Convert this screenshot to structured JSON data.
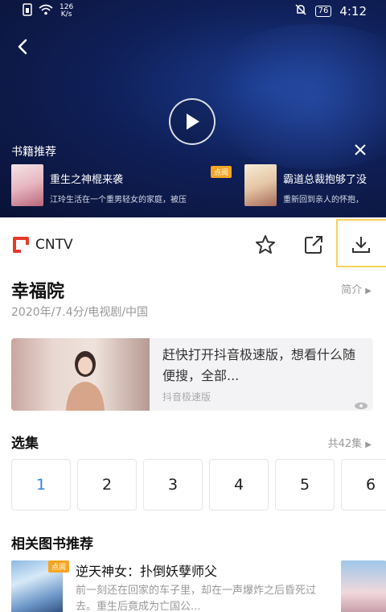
{
  "status_bar": {
    "speed_value": "126",
    "speed_unit": "K/s",
    "battery": "76",
    "time": "4:12"
  },
  "video": {
    "book_rec_title": "书籍推荐",
    "book_cards": [
      {
        "name": "重生之神棍来袭",
        "desc": "江玲生活在一个重男轻女的家庭，被压",
        "badge": "点阅"
      },
      {
        "name": "霸道总裁抱够了没",
        "desc": "重新回到亲人的怀抱，"
      }
    ]
  },
  "source": {
    "name": "CNTV"
  },
  "show": {
    "title": "幸福院",
    "meta": "2020年/7.4分/电视剧/中国",
    "intro_label": "简介"
  },
  "ad": {
    "text": "赶快打开抖音极速版，想看什么随便搜，全部...",
    "source": "抖音极速版"
  },
  "episodes": {
    "title": "选集",
    "total": "共42集",
    "items": [
      "1",
      "2",
      "3",
      "4",
      "5",
      "6"
    ]
  },
  "related": {
    "title": "相关图书推荐",
    "book": {
      "badge": "点阅",
      "name": "逆天神女：扑倒妖孽师父",
      "desc": "前一刻还在回家的车子里，却在一声爆炸之后昏死过去。重生后竟成为亡国公..."
    }
  },
  "colors": {
    "accent_blue": "#2f86d8",
    "cntv_red": "#e33b2c",
    "badge_orange": "#f5a623",
    "video_bg": "#0f1f57"
  }
}
